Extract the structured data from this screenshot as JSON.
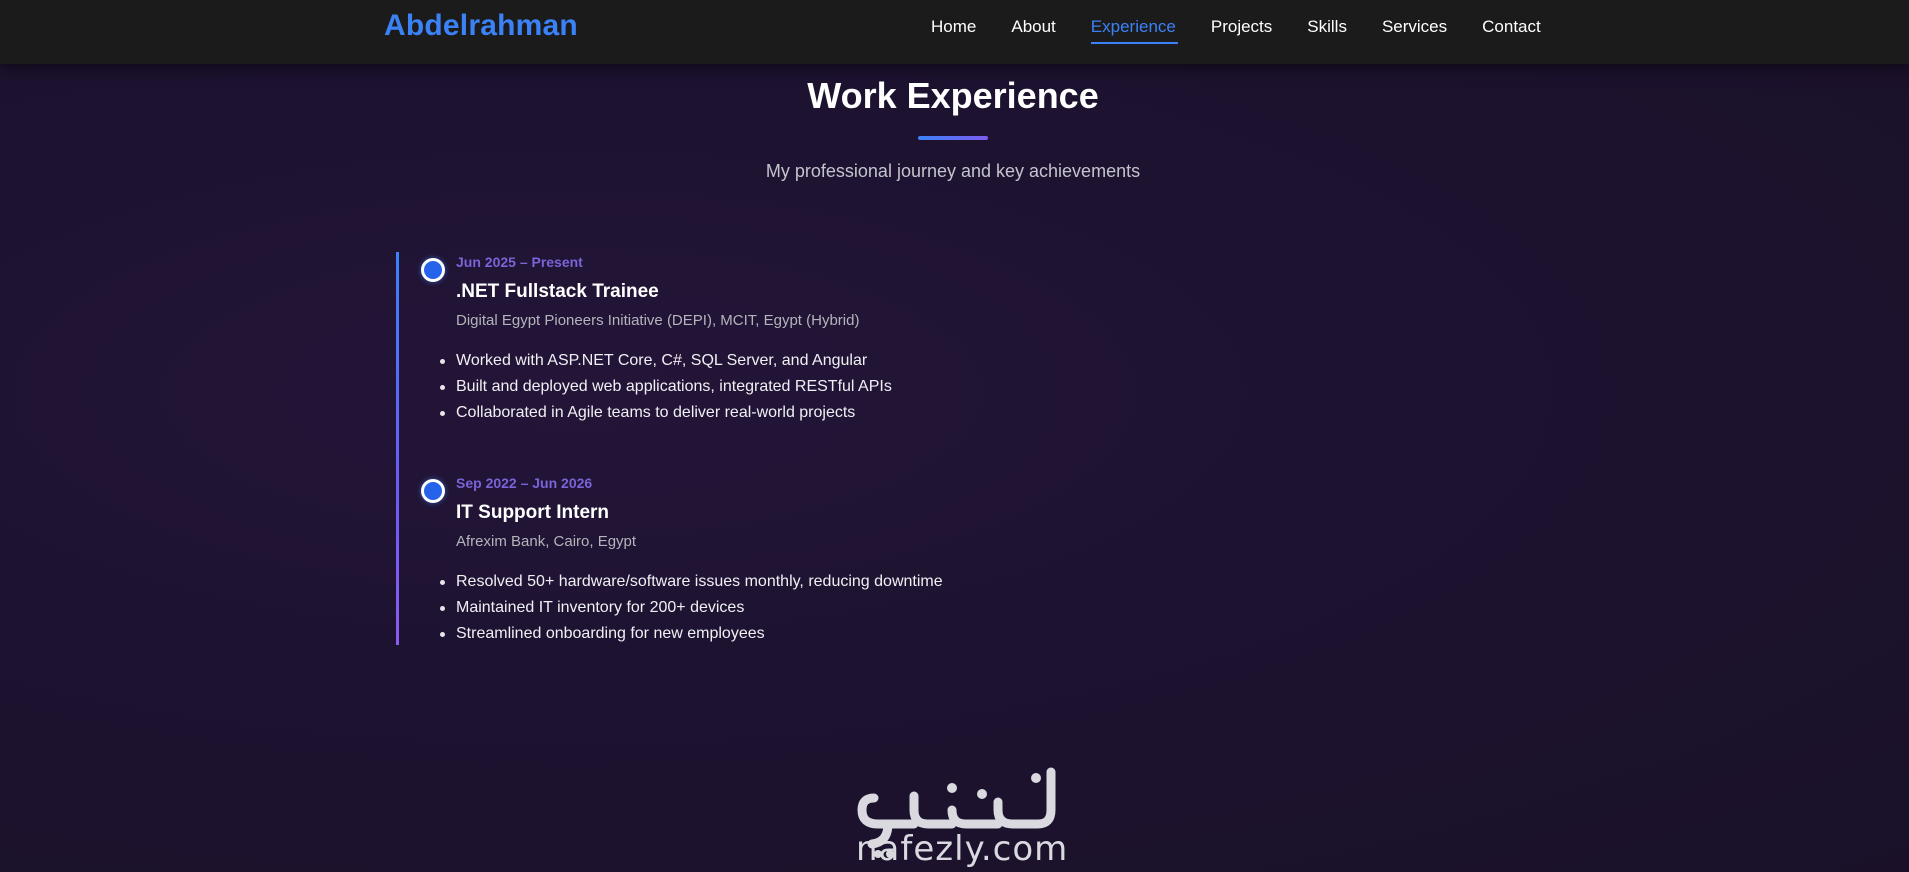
{
  "nav": {
    "brand": "Abdelrahman",
    "links": [
      {
        "label": "Home"
      },
      {
        "label": "About"
      },
      {
        "label": "Experience"
      },
      {
        "label": "Projects"
      },
      {
        "label": "Skills"
      },
      {
        "label": "Services"
      },
      {
        "label": "Contact"
      }
    ],
    "active": "Experience"
  },
  "section": {
    "title": "Work Experience",
    "subtitle": "My professional journey and key achievements"
  },
  "experience": [
    {
      "date": "Jun 2025 – Present",
      "role": ".NET Fullstack Trainee",
      "org": "Digital Egypt Pioneers Initiative (DEPI), MCIT, Egypt (Hybrid)",
      "bullets": [
        "Worked with ASP.NET Core, C#, SQL Server, and Angular",
        "Built and deployed web applications, integrated RESTful APIs",
        "Collaborated in Agile teams to deliver real-world projects"
      ]
    },
    {
      "date": "Sep 2022 – Jun 2026",
      "role": "IT Support Intern",
      "org": "Afrexim Bank, Cairo, Egypt",
      "bullets": [
        "Resolved 50+ hardware/software issues monthly, reducing downtime",
        "Maintained IT inventory for 200+ devices",
        "Streamlined onboarding for new employees"
      ]
    }
  ],
  "watermark": {
    "arabic": "نفذلي",
    "latin": "nafezly.com"
  },
  "colors": {
    "accent": "#3b82f6",
    "date": "#7b63d8",
    "navbar": "#1b1b1b",
    "background": "#1d1230"
  }
}
